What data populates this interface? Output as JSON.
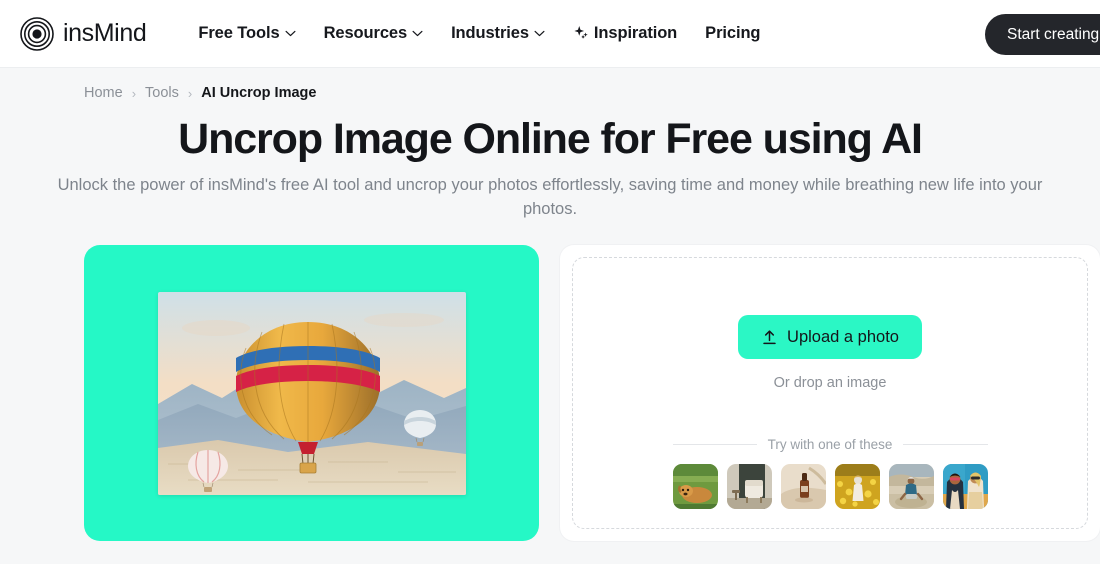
{
  "header": {
    "brand": {
      "logo_icon": "insmind-target-logo",
      "name": "insMind"
    },
    "nav": [
      {
        "label": "Free Tools",
        "has_caret": true,
        "icon": null
      },
      {
        "label": "Resources",
        "has_caret": true,
        "icon": null
      },
      {
        "label": "Industries",
        "has_caret": true,
        "icon": null
      },
      {
        "label": "Inspiration",
        "has_caret": false,
        "icon": "sparkle-icon"
      },
      {
        "label": "Pricing",
        "has_caret": false,
        "icon": null
      }
    ],
    "cta_label": "Start creating",
    "cta_color": "#24262b"
  },
  "breadcrumb": {
    "separator": "›",
    "items": [
      {
        "label": "Home",
        "current": false
      },
      {
        "label": "Tools",
        "current": false
      },
      {
        "label": "AI Uncrop Image",
        "current": true
      }
    ]
  },
  "hero": {
    "title": "Uncrop Image Online for Free using AI",
    "subtitle": "Unlock the power of insMind's free AI tool and uncrop your photos effortlessly, saving time and money while breathing new life into your photos."
  },
  "preview": {
    "background_color": "#25f8c6",
    "image_alt": "hot-air-balloon-over-mountains"
  },
  "upload": {
    "button_label": "Upload a photo",
    "button_icon": "upload-arrow-icon",
    "button_color": "#2bf7c5",
    "drop_hint": "Or drop an image",
    "samples_label": "Try with one of these",
    "samples": [
      {
        "alt": "golden-dog-on-grass"
      },
      {
        "alt": "armchair-interior"
      },
      {
        "alt": "amber-serum-bottle"
      },
      {
        "alt": "woman-in-yellow-flower-field"
      },
      {
        "alt": "man-sitting-on-rocks"
      },
      {
        "alt": "two-women-illustration-sunglasses"
      }
    ]
  }
}
